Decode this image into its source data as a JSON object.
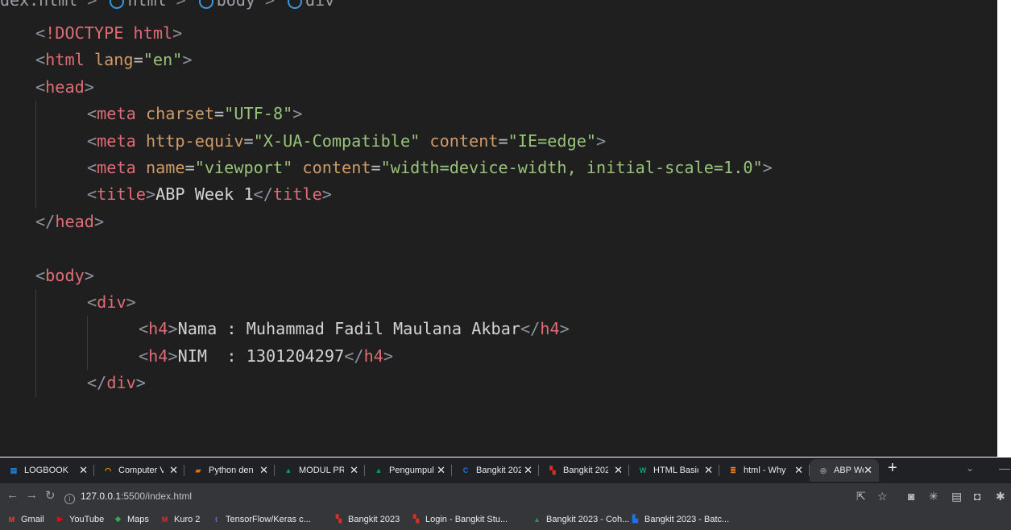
{
  "editor": {
    "breadcrumb": [
      "dex.html",
      "html",
      "body",
      "div"
    ],
    "lines": [
      {
        "indent": 0,
        "parts": [
          [
            "punc",
            "<"
          ],
          [
            "doct",
            "!DOCTYPE html"
          ],
          [
            "punc",
            ">"
          ]
        ]
      },
      {
        "indent": 0,
        "parts": [
          [
            "punc",
            "<"
          ],
          [
            "tag",
            "html"
          ],
          [
            "txt",
            " "
          ],
          [
            "attr",
            "lang"
          ],
          [
            "eq",
            "="
          ],
          [
            "str",
            "\"en\""
          ],
          [
            "punc",
            ">"
          ]
        ]
      },
      {
        "indent": 0,
        "parts": [
          [
            "punc",
            "<"
          ],
          [
            "tag",
            "head"
          ],
          [
            "punc",
            ">"
          ]
        ]
      },
      {
        "indent": 1,
        "parts": [
          [
            "punc",
            "<"
          ],
          [
            "tag",
            "meta"
          ],
          [
            "txt",
            " "
          ],
          [
            "attr",
            "charset"
          ],
          [
            "eq",
            "="
          ],
          [
            "str",
            "\"UTF-8\""
          ],
          [
            "punc",
            ">"
          ]
        ]
      },
      {
        "indent": 1,
        "parts": [
          [
            "punc",
            "<"
          ],
          [
            "tag",
            "meta"
          ],
          [
            "txt",
            " "
          ],
          [
            "attr",
            "http-equiv"
          ],
          [
            "eq",
            "="
          ],
          [
            "str",
            "\"X-UA-Compatible\""
          ],
          [
            "txt",
            " "
          ],
          [
            "attr",
            "content"
          ],
          [
            "eq",
            "="
          ],
          [
            "str",
            "\"IE=edge\""
          ],
          [
            "punc",
            ">"
          ]
        ]
      },
      {
        "indent": 1,
        "parts": [
          [
            "punc",
            "<"
          ],
          [
            "tag",
            "meta"
          ],
          [
            "txt",
            " "
          ],
          [
            "attr",
            "name"
          ],
          [
            "eq",
            "="
          ],
          [
            "str",
            "\"viewport\""
          ],
          [
            "txt",
            " "
          ],
          [
            "attr",
            "content"
          ],
          [
            "eq",
            "="
          ],
          [
            "str",
            "\"width=device-width, initial-scale=1.0\""
          ],
          [
            "punc",
            ">"
          ]
        ]
      },
      {
        "indent": 1,
        "parts": [
          [
            "punc",
            "<"
          ],
          [
            "tag",
            "title"
          ],
          [
            "punc",
            ">"
          ],
          [
            "txt",
            "ABP Week 1"
          ],
          [
            "punc",
            "</"
          ],
          [
            "tag",
            "title"
          ],
          [
            "punc",
            ">"
          ]
        ]
      },
      {
        "indent": 0,
        "parts": [
          [
            "punc",
            "</"
          ],
          [
            "tag",
            "head"
          ],
          [
            "punc",
            ">"
          ]
        ]
      },
      {
        "indent": 0,
        "parts": []
      },
      {
        "indent": 0,
        "parts": [
          [
            "punc",
            "<"
          ],
          [
            "tag",
            "body"
          ],
          [
            "punc",
            ">"
          ]
        ]
      },
      {
        "indent": 1,
        "parts": [
          [
            "punc",
            "<"
          ],
          [
            "tag",
            "div"
          ],
          [
            "punc",
            ">"
          ]
        ]
      },
      {
        "indent": 2,
        "parts": [
          [
            "punc",
            "<"
          ],
          [
            "tag",
            "h4"
          ],
          [
            "punc",
            ">"
          ],
          [
            "txt",
            "Nama : Muhammad Fadil Maulana Akbar"
          ],
          [
            "punc",
            "</"
          ],
          [
            "tag",
            "h4"
          ],
          [
            "punc",
            ">"
          ]
        ]
      },
      {
        "indent": 2,
        "parts": [
          [
            "punc",
            "<"
          ],
          [
            "tag",
            "h4"
          ],
          [
            "punc",
            ">"
          ],
          [
            "txt",
            "NIM  : 1301204297"
          ],
          [
            "punc",
            "</"
          ],
          [
            "tag",
            "h4"
          ],
          [
            "punc",
            ">"
          ]
        ]
      },
      {
        "indent": 1,
        "parts": [
          [
            "punc",
            "</"
          ],
          [
            "tag",
            "div"
          ],
          [
            "punc",
            ">"
          ]
        ]
      }
    ]
  },
  "browser": {
    "tabs": [
      {
        "label": "LOGBOOK I",
        "icon": "logbook-icon",
        "color": "#1e88e5",
        "glyph": "▤"
      },
      {
        "label": "Computer V",
        "icon": "computer-vision-icon",
        "color": "#f9ab00",
        "glyph": "◠"
      },
      {
        "label": "Python den",
        "icon": "book-icon",
        "color": "#e37400",
        "glyph": "▰"
      },
      {
        "label": "MODUL PR",
        "icon": "google-drive-icon",
        "color": "#0f9d58",
        "glyph": "▲"
      },
      {
        "label": "Pengumpul",
        "icon": "google-drive-icon",
        "color": "#0f9d58",
        "glyph": "▲"
      },
      {
        "label": "Bangkit 202",
        "icon": "coursera-icon",
        "color": "#1a73e8",
        "glyph": "C"
      },
      {
        "label": "Bangkit 202",
        "icon": "bangkit-icon",
        "color": "#d93025",
        "glyph": "▚"
      },
      {
        "label": "HTML Basic",
        "icon": "w3schools-icon",
        "color": "#04aa6d",
        "glyph": "W"
      },
      {
        "label": "html - Why",
        "icon": "stackoverflow-icon",
        "color": "#f48024",
        "glyph": "≣"
      },
      {
        "label": "ABP Week",
        "icon": "globe-icon",
        "color": "#9aa0a6",
        "glyph": "◎",
        "active": true
      }
    ],
    "new_tab": "+",
    "url_host": "127.0.0.1",
    "url_path": ":5500/index.html",
    "bookmarks": [
      {
        "label": "Gmail",
        "icon": "gmail-icon",
        "color": "#ea4335",
        "glyph": "M"
      },
      {
        "label": "YouTube",
        "icon": "youtube-icon",
        "color": "#ff0000",
        "glyph": "▶"
      },
      {
        "label": "Maps",
        "icon": "maps-icon",
        "color": "#34a853",
        "glyph": "◆"
      },
      {
        "label": "Kuro 2",
        "icon": "kuro-icon",
        "color": "#d93025",
        "glyph": "M"
      },
      {
        "label": "TensorFlow/Keras c...",
        "icon": "tds-icon",
        "color": "#5e6ad2",
        "glyph": "t"
      },
      {
        "label": "Bangkit 2023",
        "icon": "bangkit-icon",
        "color": "#d93025",
        "glyph": "▚"
      },
      {
        "label": "Login - Bangkit Stu...",
        "icon": "bangkit-icon",
        "color": "#d93025",
        "glyph": "▚"
      },
      {
        "label": "Bangkit 2023 - Coh...",
        "icon": "google-drive-icon",
        "color": "#0f9d58",
        "glyph": "▲"
      },
      {
        "label": "Bangkit 2023 - Batc...",
        "icon": "google-classroom-icon",
        "color": "#1a73e8",
        "glyph": "▙"
      }
    ]
  }
}
